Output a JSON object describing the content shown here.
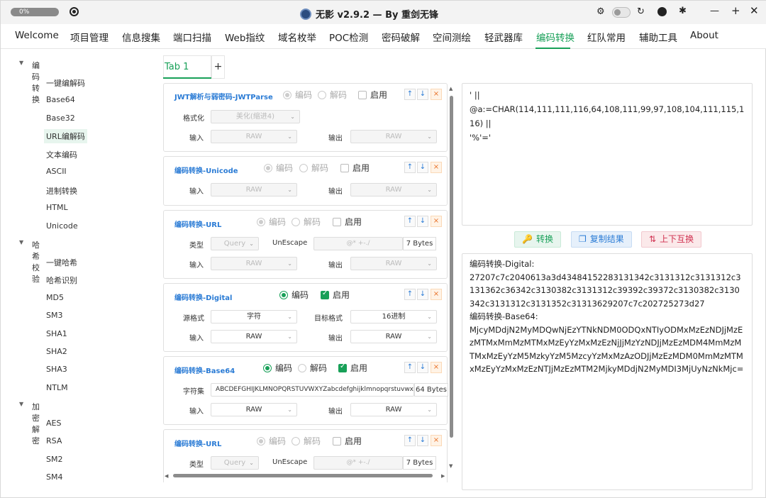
{
  "titlebar": {
    "progress": "0%",
    "title": "无影 v2.9.2 — By 重剑无锋"
  },
  "nav_tabs": [
    "Welcome",
    "项目管理",
    "信息搜集",
    "端口扫描",
    "Web指纹",
    "域名枚举",
    "POC检测",
    "密码破解",
    "空间测绘",
    "轻武器库",
    "编码转换",
    "红队常用",
    "辅助工具",
    "About"
  ],
  "active_nav": "编码转换",
  "sidebar": {
    "group1": "编码转换",
    "group1_items": [
      "一键编解码",
      "Base64",
      "Base32",
      "URL编解码",
      "文本编码",
      "ASCII",
      "进制转换",
      "HTML",
      "Unicode"
    ],
    "group2": "哈希校验",
    "group2_items": [
      "一键哈希",
      "哈希识别",
      "MD5",
      "SM3",
      "SHA1",
      "SHA2",
      "SHA3",
      "NTLM"
    ],
    "group3": "加密解密",
    "group3_items": [
      "AES",
      "RSA",
      "SM2",
      "SM4"
    ],
    "selected": "URL编解码"
  },
  "subtab": {
    "label": "Tab 1",
    "add": "+"
  },
  "common": {
    "encode": "编码",
    "decode": "解码",
    "enable": "启用",
    "input": "输入",
    "output": "输出",
    "raw": "RAW",
    "up": "↑",
    "down": "↓",
    "close": "×"
  },
  "cards": [
    {
      "title": "JWT解析与弱密码-JWTParse",
      "format_label": "格式化",
      "format_value": "美化(缩进4)"
    },
    {
      "title": "编码转换-Unicode"
    },
    {
      "title": "编码转换-URL",
      "type_label": "类型",
      "type_value": "Query",
      "unescape_label": "UnEscape",
      "unescape_placeholder": "@* +-./",
      "bytes": "7 Bytes"
    },
    {
      "title": "编码转换-Digital",
      "src_label": "源格式",
      "src_value": "字符",
      "target_label": "目标格式",
      "target_value": "16进制"
    },
    {
      "title": "编码转换-Base64",
      "charset_label": "字符集",
      "charset_value": "ABCDEFGHIJKLMNOPQRSTUVWXYZabcdefghijklmnopqrstuvwxyz0123456789+/=",
      "bytes": "64 Bytes"
    },
    {
      "title": "编码转换-URL",
      "type_label": "类型",
      "type_value": "Query",
      "unescape_label": "UnEscape",
      "unescape_placeholder": "@* +-./",
      "bytes": "7 Bytes"
    }
  ],
  "input_text": "' ||\n@a:=CHAR(114,111,111,116,64,108,111,99,97,108,104,111,115,116) ||\n'%'='",
  "buttons": {
    "convert": "转换",
    "copy": "复制结果",
    "swap": "上下互换"
  },
  "output_text": "编码转换-Digital:\n27207c7c2040613a3d43484152283131342c3131312c3131312c3131362c36342c3130382c3131312c39392c39372c3130382c3130342c3131312c3131352c31313629207c7c202725273d27\n编码转换-Base64:\nMjcyMDdjN2MyMDQwNjEzYTNkNDM0ODQxNTIyODMxMzEzNDJjMzEzMTMxMmMzMTMxMzEyYzMxMzEzNjJjMzYzNDJjMzEzMDM4MmMzMTMxMzEyYzM5MzkyYzM5MzcyYzMxMzAzODJjMzEzMDM0MmMzMTMxMzEyYzMxMzEzNTJjMzEzMTM2MjkyMDdjN2MyMDI3MjUyNzNkMjc="
}
